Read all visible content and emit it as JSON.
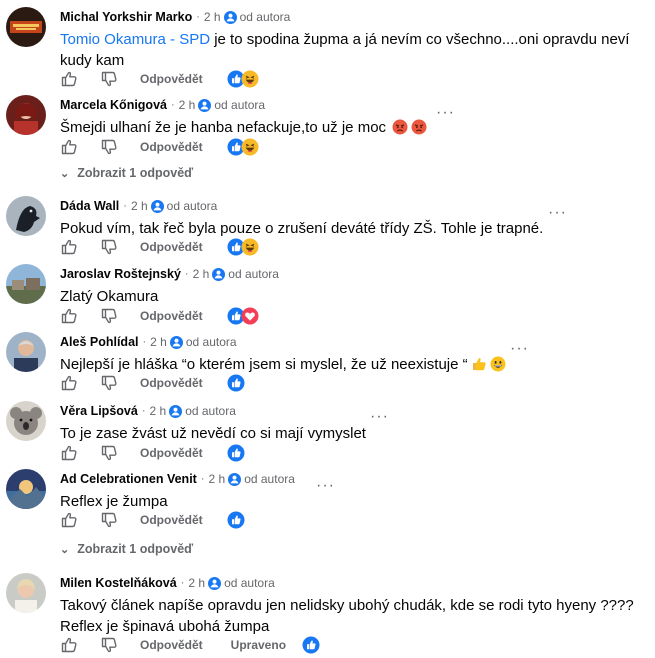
{
  "common": {
    "separator": "·",
    "reply_label": "Odpovědět",
    "author_badge": "od autora",
    "more_label": "···"
  },
  "comments": [
    {
      "author": "Michal Yorkshir Marko",
      "time": "2 h",
      "mention": "Tomio Okamura - SPD",
      "text_line1": " je to spodina župma a já nevím co všechno....oni opravdu neví",
      "text_line2": "kudy kam",
      "reactions": [
        "like",
        "haha"
      ]
    },
    {
      "author": "Marcela Kőnigová",
      "time": "2 h",
      "text": "Šmejdi ulhaní že je hanba nefackuje,to už je moc",
      "emojis": [
        "angry-face",
        "angry-face"
      ],
      "reactions": [
        "like",
        "haha"
      ],
      "replies_toggle": "Zobrazit 1 odpověď"
    },
    {
      "author": "Dáda Wall",
      "time": "2 h",
      "text": "Pokud vím, tak řeč byla pouze o zrušení deváté třídy ZŠ. Tohle je trapné.",
      "reactions": [
        "like",
        "haha"
      ]
    },
    {
      "author": "Jaroslav Roštejnský",
      "time": "2 h",
      "text": "Zlatý Okamura",
      "reactions": [
        "like",
        "love"
      ]
    },
    {
      "author": "Aleš Pohlídal",
      "time": "2 h",
      "text": "Nejlepší je hláška “o kterém jsem si myslel, že už neexistuje “",
      "emojis": [
        "thumbs-up",
        "grinning-face"
      ],
      "reactions": [
        "like"
      ]
    },
    {
      "author": "Věra Lipšová",
      "time": "2 h",
      "text": "To je zase žvást už nevědí co si mají vymyslet",
      "reactions": [
        "like"
      ]
    },
    {
      "author": "Ad Celebrationen Venit",
      "time": "2 h",
      "text": "Reflex je žumpa",
      "reactions": [
        "like"
      ],
      "replies_toggle": "Zobrazit 1 odpověď"
    },
    {
      "author": "Milen Kostelňáková",
      "time": "2 h",
      "text_line1": "Takový článek napíše opravdu jen nelidsky ubohý chudák, kde se rodi tyto hyeny ????",
      "text_line2": "Reflex je špinavá ubohá žumpa",
      "edited_label": "Upraveno",
      "reactions": [
        "like"
      ]
    }
  ],
  "colors": {
    "link_blue": "#1877f2",
    "meta_gray": "#65676b",
    "text": "#050505",
    "like_blue": "#1877f2",
    "love_red": "#f33e58",
    "haha_yellow": "#f7b928"
  }
}
